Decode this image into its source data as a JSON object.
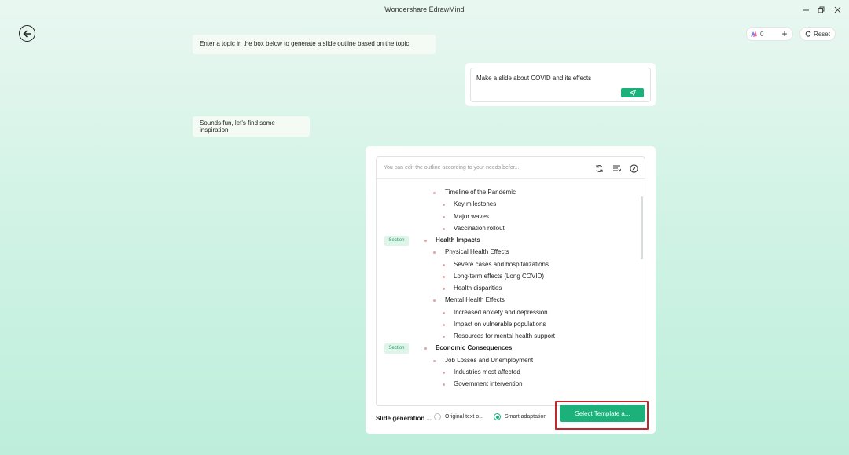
{
  "window": {
    "title": "Wondershare EdrawMind",
    "controls": [
      "minimize-icon",
      "restore-icon",
      "close-icon"
    ]
  },
  "header": {
    "credits_value": "0",
    "add_label": "+",
    "reset_label": "Reset"
  },
  "chat": {
    "intro_message": "Enter a topic in the box below to generate a slide outline based on the topic.",
    "user_prompt": "Make a slide about COVID and its effects",
    "reply_message": "Sounds fun, let's find some inspiration"
  },
  "outline": {
    "hint": "You can edit the outline according to your needs befor...",
    "section_tag": "Section",
    "items": [
      {
        "level": 2,
        "text": "Timeline of the Pandemic",
        "section": false
      },
      {
        "level": 3,
        "text": "Key milestones",
        "section": false
      },
      {
        "level": 3,
        "text": "Major waves",
        "section": false
      },
      {
        "level": 3,
        "text": "Vaccination rollout",
        "section": false
      },
      {
        "level": 1,
        "text": "Health Impacts",
        "section": true
      },
      {
        "level": 2,
        "text": "Physical Health Effects",
        "section": false
      },
      {
        "level": 3,
        "text": "Severe cases and hospitalizations",
        "section": false
      },
      {
        "level": 3,
        "text": "Long-term effects (Long COVID)",
        "section": false
      },
      {
        "level": 3,
        "text": "Health disparities",
        "section": false
      },
      {
        "level": 2,
        "text": "Mental Health Effects",
        "section": false
      },
      {
        "level": 3,
        "text": "Increased anxiety and depression",
        "section": false
      },
      {
        "level": 3,
        "text": "Impact on vulnerable populations",
        "section": false
      },
      {
        "level": 3,
        "text": "Resources for mental health support",
        "section": false
      },
      {
        "level": 1,
        "text": "Economic Consequences",
        "section": true
      },
      {
        "level": 2,
        "text": "Job Losses and Unemployment",
        "section": false
      },
      {
        "level": 3,
        "text": "Industries most affected",
        "section": false
      },
      {
        "level": 3,
        "text": "Government intervention",
        "section": false
      }
    ]
  },
  "generation": {
    "label": "Slide generation ...",
    "options": [
      {
        "label": "Original text o...",
        "selected": false
      },
      {
        "label": "Smart adaptation",
        "selected": true
      }
    ],
    "select_template_label": "Select Template a..."
  },
  "colors": {
    "accent": "#1cb07a",
    "highlight_border": "#c3262d",
    "section_tag_bg": "#def5ea"
  }
}
